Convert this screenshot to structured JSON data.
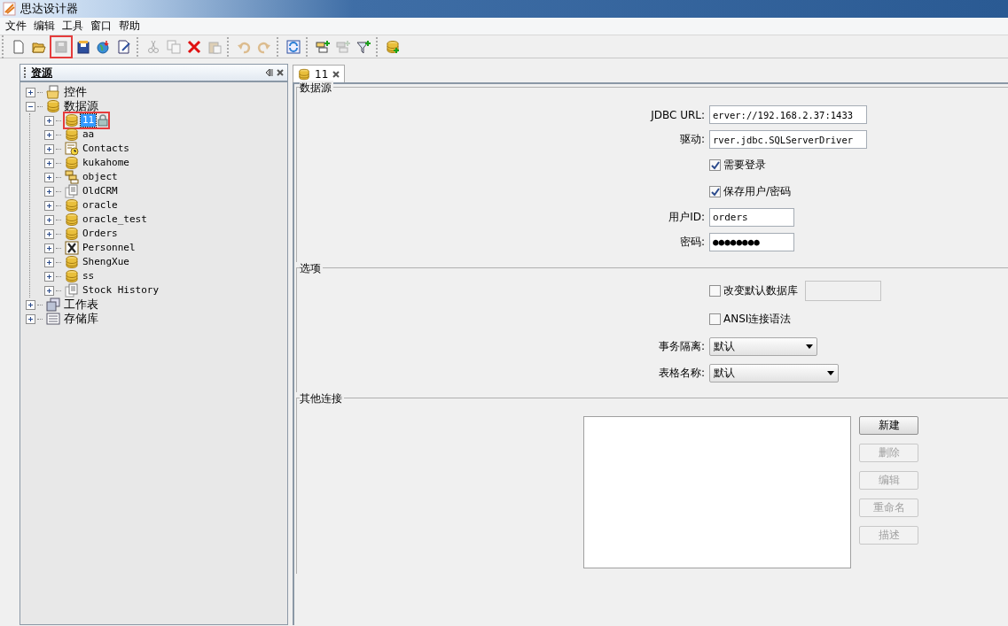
{
  "window": {
    "title": "思达设计器"
  },
  "menu": [
    "文件",
    "编辑",
    "工具",
    "窗口",
    "帮助"
  ],
  "toolbar": [
    [
      {
        "kind": "new",
        "disabled": false,
        "highlighted": false
      },
      {
        "kind": "open",
        "disabled": false,
        "highlighted": false
      },
      {
        "kind": "save",
        "disabled": true,
        "highlighted": true
      },
      {
        "kind": "saveas",
        "disabled": false,
        "highlighted": false
      },
      {
        "kind": "publish",
        "disabled": false,
        "highlighted": false
      },
      {
        "kind": "edit",
        "disabled": false,
        "highlighted": false
      }
    ],
    [
      {
        "kind": "cut",
        "disabled": true,
        "highlighted": false
      },
      {
        "kind": "copy",
        "disabled": true,
        "highlighted": false
      },
      {
        "kind": "delete",
        "disabled": false,
        "highlighted": false
      },
      {
        "kind": "paste",
        "disabled": true,
        "highlighted": false
      }
    ],
    [
      {
        "kind": "undo",
        "disabled": true,
        "highlighted": false
      },
      {
        "kind": "redo",
        "disabled": true,
        "highlighted": false
      }
    ],
    [
      {
        "kind": "refresh",
        "disabled": false,
        "highlighted": false
      }
    ],
    [
      {
        "kind": "addtable",
        "disabled": false,
        "highlighted": false
      },
      {
        "kind": "table",
        "disabled": true,
        "highlighted": false
      },
      {
        "kind": "filter",
        "disabled": false,
        "highlighted": false
      }
    ],
    [
      {
        "kind": "dbadd",
        "disabled": false,
        "highlighted": false
      }
    ]
  ],
  "resource_panel": {
    "title": "资源",
    "tree": [
      {
        "label": "控件",
        "kind": "widget",
        "expanded": false,
        "selected": false,
        "highlighted": false
      },
      {
        "label": "数据源",
        "kind": "database",
        "expanded": true,
        "selected": false,
        "highlighted": false,
        "children": [
          {
            "label": "11",
            "kind": "database",
            "expanded": false,
            "selected": true,
            "locked": true,
            "highlighted": true
          },
          {
            "label": "aa",
            "kind": "database",
            "expanded": false,
            "selected": false,
            "locked": false,
            "highlighted": false
          },
          {
            "label": "Contacts",
            "kind": "form",
            "expanded": false,
            "selected": false,
            "locked": false,
            "highlighted": false
          },
          {
            "label": "kukahome",
            "kind": "database",
            "expanded": false,
            "selected": false,
            "locked": false,
            "highlighted": false
          },
          {
            "label": "object",
            "kind": "object",
            "expanded": false,
            "selected": false,
            "locked": false,
            "highlighted": false
          },
          {
            "label": "OldCRM",
            "kind": "file",
            "expanded": false,
            "selected": false,
            "locked": false,
            "highlighted": false
          },
          {
            "label": "oracle",
            "kind": "database",
            "expanded": false,
            "selected": false,
            "locked": false,
            "highlighted": false
          },
          {
            "label": "oracle_test",
            "kind": "database",
            "expanded": false,
            "selected": false,
            "locked": false,
            "highlighted": false
          },
          {
            "label": "Orders",
            "kind": "database",
            "expanded": false,
            "selected": false,
            "locked": false,
            "highlighted": false
          },
          {
            "label": "Personnel",
            "kind": "excel",
            "expanded": false,
            "selected": false,
            "locked": false,
            "highlighted": false
          },
          {
            "label": "ShengXue",
            "kind": "database",
            "expanded": false,
            "selected": false,
            "locked": false,
            "highlighted": false
          },
          {
            "label": "ss",
            "kind": "database",
            "expanded": false,
            "selected": false,
            "locked": false,
            "highlighted": false
          },
          {
            "label": "Stock History",
            "kind": "file",
            "expanded": false,
            "selected": false,
            "locked": false,
            "highlighted": false
          }
        ]
      },
      {
        "label": "工作表",
        "kind": "sheet",
        "expanded": false,
        "selected": false,
        "highlighted": false
      },
      {
        "label": "存储库",
        "kind": "store",
        "expanded": false,
        "selected": false,
        "highlighted": false
      }
    ]
  },
  "tabs": [
    {
      "label": "11",
      "selected": true
    }
  ],
  "sections": [
    {
      "title": "数据源",
      "rows": [
        {
          "kind": "text",
          "label": "JDBC URL:",
          "value": "erver://192.168.2.37:1433"
        },
        {
          "kind": "text",
          "label": "驱动:",
          "value": "rver.jdbc.SQLServerDriver"
        },
        {
          "kind": "check",
          "label": "需要登录",
          "checked": true
        },
        {
          "kind": "check",
          "label": "保存用户/密码",
          "checked": true
        },
        {
          "kind": "short_text",
          "label": "用户ID:",
          "value": "orders"
        },
        {
          "kind": "short_text",
          "label": "密码:",
          "value": "●●●●●●●●"
        }
      ]
    },
    {
      "title": "选项",
      "rows": [
        {
          "kind": "check_field",
          "label": "改变默认数据库",
          "checked": false
        },
        {
          "kind": "check",
          "label": "ANSI连接语法",
          "checked": false
        },
        {
          "kind": "short_select",
          "label": "事务隔离:",
          "value": "默认"
        },
        {
          "kind": "select",
          "label": "表格名称:",
          "value": "默认"
        }
      ]
    },
    {
      "title": "其他连接",
      "buttons": [
        {
          "label": "新建",
          "disabled": false
        },
        {
          "label": "删除",
          "disabled": true
        },
        {
          "label": "编辑",
          "disabled": true
        },
        {
          "label": "重命名",
          "disabled": true
        },
        {
          "label": "描述",
          "disabled": true
        }
      ]
    }
  ]
}
